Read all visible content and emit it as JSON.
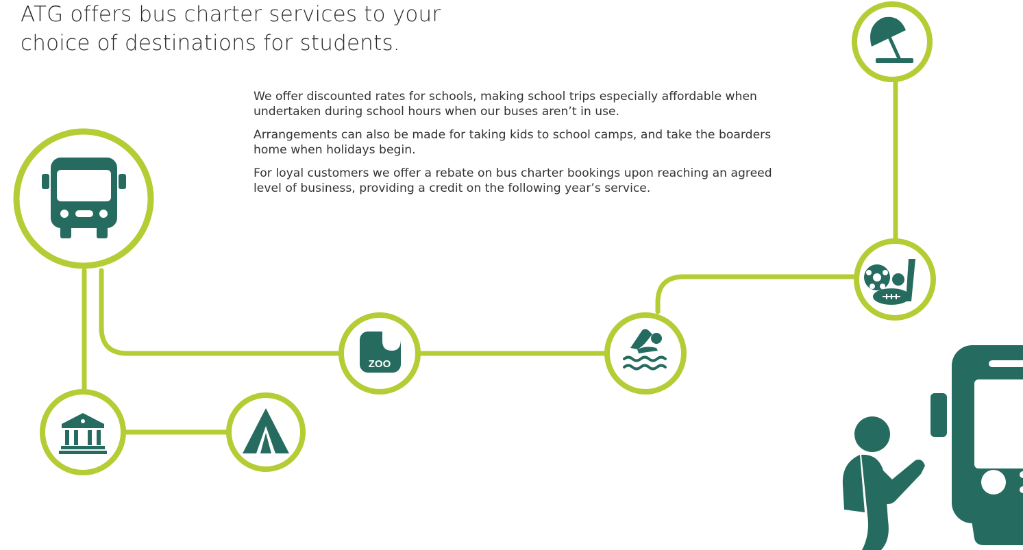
{
  "headline": {
    "line1": "ATG offers bus charter services to your",
    "line2": "choice of destinations for students."
  },
  "body": {
    "paragraph1": "We offer discounted rates for schools, making school trips especially affordable when undertaken during school hours when our buses aren’t in use.",
    "paragraph2": "Arrangements can also be made for taking kids to school camps, and take the boarders home when holidays begin.",
    "paragraph3": "For loyal customers we offer a rebate on bus charter bookings upon reaching an agreed level of business, providing a credit on the following year’s service."
  },
  "icons": {
    "bus": "bus-icon",
    "museum": "museum-icon",
    "tent": "tent-icon",
    "zoo": "zoo-icon",
    "zoo_label": "ZOO",
    "swimmer": "swimmer-icon",
    "sports": "sports-balls-icon",
    "beach": "beach-umbrella-icon",
    "student": "student-backpack-icon",
    "bus_large": "bus-front-icon"
  },
  "colors": {
    "accent_green": "#b5cc35",
    "icon_teal": "#256b5f",
    "text_dark": "#333333"
  }
}
